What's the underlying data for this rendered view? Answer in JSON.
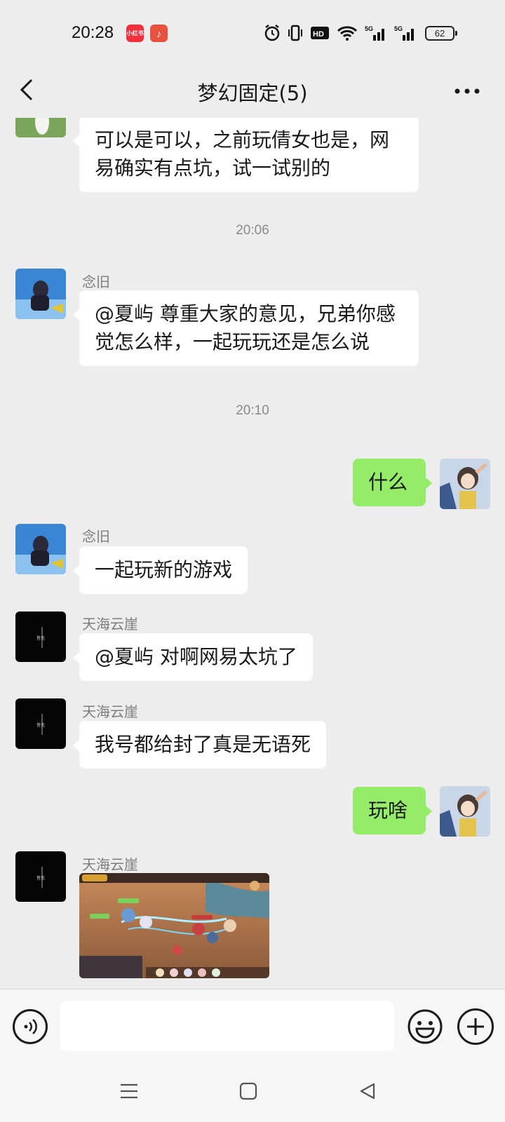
{
  "status_bar": {
    "time": "20:28",
    "xhs_badge": "小红书",
    "music_badge": "♪",
    "battery": "62",
    "icons": [
      "alarm-icon",
      "vibrate-icon",
      "hd-icon",
      "wifi-icon",
      "signal-5g-icon",
      "signal-5g-icon",
      "battery-icon"
    ]
  },
  "header": {
    "title": "梦幻固定(5)"
  },
  "chat": {
    "timestamps": [
      "20:06",
      "20:10"
    ],
    "messages": [
      {
        "side": "left",
        "sender": "",
        "text": "可以是可以，之前玩倩女也是，网易确实有点坑，试一试别的"
      },
      {
        "side": "left",
        "sender": "念旧",
        "text": "@夏屿  尊重大家的意见，兄弟你感觉怎么样，一起玩玩还是怎么说"
      },
      {
        "side": "right",
        "sender": "",
        "text": "什么"
      },
      {
        "side": "left",
        "sender": "念旧",
        "text": "一起玩新的游戏"
      },
      {
        "side": "left",
        "sender": "天海云崖",
        "text": "@夏屿  对啊网易太坑了"
      },
      {
        "side": "left",
        "sender": "天海云崖",
        "text": "我号都给封了真是无语死"
      },
      {
        "side": "right",
        "sender": "",
        "text": "玩啥"
      },
      {
        "side": "left",
        "sender": "天海云崖",
        "text": "",
        "image": "game-screenshot"
      }
    ]
  },
  "input_bar": {
    "placeholder": "",
    "value": ""
  },
  "colors": {
    "background": "#ededed",
    "bubble_left": "#ffffff",
    "bubble_right": "#95ec69",
    "timestamp": "#8a8a8a"
  }
}
